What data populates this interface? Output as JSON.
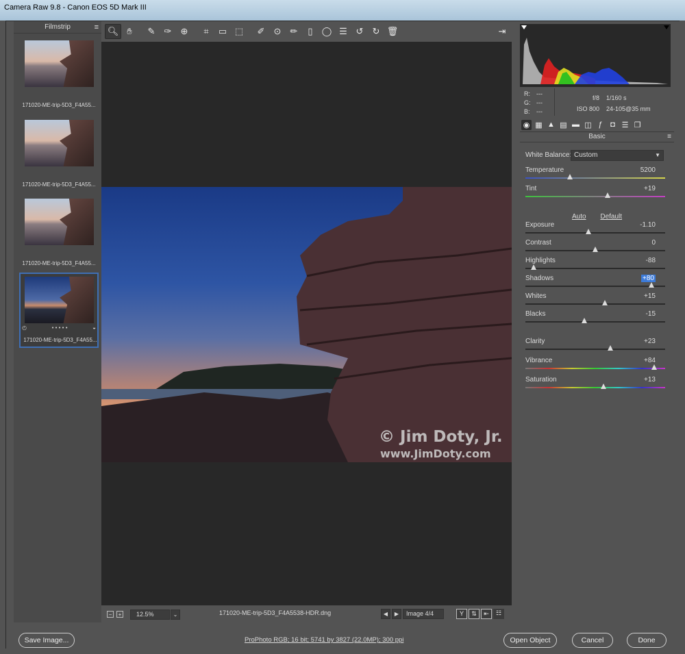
{
  "window": {
    "title": "Camera Raw 9.8  -  Canon EOS 5D Mark III"
  },
  "filmstrip": {
    "header": "Filmstrip",
    "menu_icon": "≡",
    "items": [
      {
        "caption": "171020-ME-trip-5D3_F4A55..."
      },
      {
        "caption": "171020-ME-trip-5D3_F4A55..."
      },
      {
        "caption": "171020-ME-trip-5D3_F4A55..."
      },
      {
        "caption": "171020-ME-trip-5D3_F4A55...",
        "selected": true,
        "stars": "• • • • •"
      }
    ]
  },
  "toolbar": {
    "tools": [
      "zoom-icon",
      "hand-icon",
      "white-balance-icon",
      "color-sampler-icon",
      "targeted-adjustment-icon",
      "crop-icon",
      "straighten-icon",
      "transform-icon",
      "spot-removal-icon",
      "red-eye-icon",
      "adjustment-brush-icon",
      "graduated-filter-icon",
      "radial-filter-icon",
      "preferences-icon",
      "rotate-left-icon",
      "rotate-right-icon",
      "delete-icon"
    ],
    "export_icon": "export-icon"
  },
  "preview": {
    "watermark_line1": "© Jim Doty, Jr.",
    "watermark_line2": "www.JimDoty.com"
  },
  "preview_bar": {
    "zoom": "12.5%",
    "filename": "171020-ME-trip-5D3_F4A5538-HDR.dng",
    "image_counter": "Image 4/4"
  },
  "readout": {
    "r_label": "R:",
    "r_value": "---",
    "g_label": "G:",
    "g_value": "---",
    "b_label": "B:",
    "b_value": "---",
    "aperture": "f/8",
    "shutter": "1/160 s",
    "iso": "ISO 800",
    "lens": "24-105@35 mm"
  },
  "panel": {
    "title": "Basic",
    "white_balance_label": "White Balance:",
    "white_balance_value": "Custom",
    "auto_label": "Auto",
    "default_label": "Default",
    "sliders": [
      {
        "label": "Temperature",
        "value": "5200",
        "position": 0.32,
        "gradient": "linear-gradient(90deg,#3b53c4,#d6d64a)"
      },
      {
        "label": "Tint",
        "value": "+19",
        "position": 0.59,
        "gradient": "linear-gradient(90deg,#3ec23e,#c43ec4)"
      },
      {
        "label": "Exposure",
        "value": "-1.10",
        "position": 0.45,
        "gradient": ""
      },
      {
        "label": "Contrast",
        "value": "0",
        "position": 0.5,
        "gradient": ""
      },
      {
        "label": "Highlights",
        "value": "-88",
        "position": 0.06,
        "gradient": ""
      },
      {
        "label": "Shadows",
        "value": "+80",
        "position": 0.9,
        "gradient": "",
        "highlight": true
      },
      {
        "label": "Whites",
        "value": "+15",
        "position": 0.57,
        "gradient": ""
      },
      {
        "label": "Blacks",
        "value": "-15",
        "position": 0.42,
        "gradient": ""
      },
      {
        "label": "Clarity",
        "value": "+23",
        "position": 0.61,
        "gradient": ""
      },
      {
        "label": "Vibrance",
        "value": "+84",
        "position": 0.92,
        "gradient": "linear-gradient(90deg,#777,#c33,#cc3,#3c3,#3cc,#33c,#c3c)"
      },
      {
        "label": "Saturation",
        "value": "+13",
        "position": 0.56,
        "gradient": "linear-gradient(90deg,#777,#c33,#cc3,#3c3,#3cc,#33c,#c3c)"
      }
    ]
  },
  "footer": {
    "save_label": "Save Image...",
    "workflow_link": "ProPhoto RGB; 16 bit; 5741 by 3827 (22.0MP); 300 ppi",
    "open_label": "Open Object",
    "cancel_label": "Cancel",
    "done_label": "Done"
  }
}
